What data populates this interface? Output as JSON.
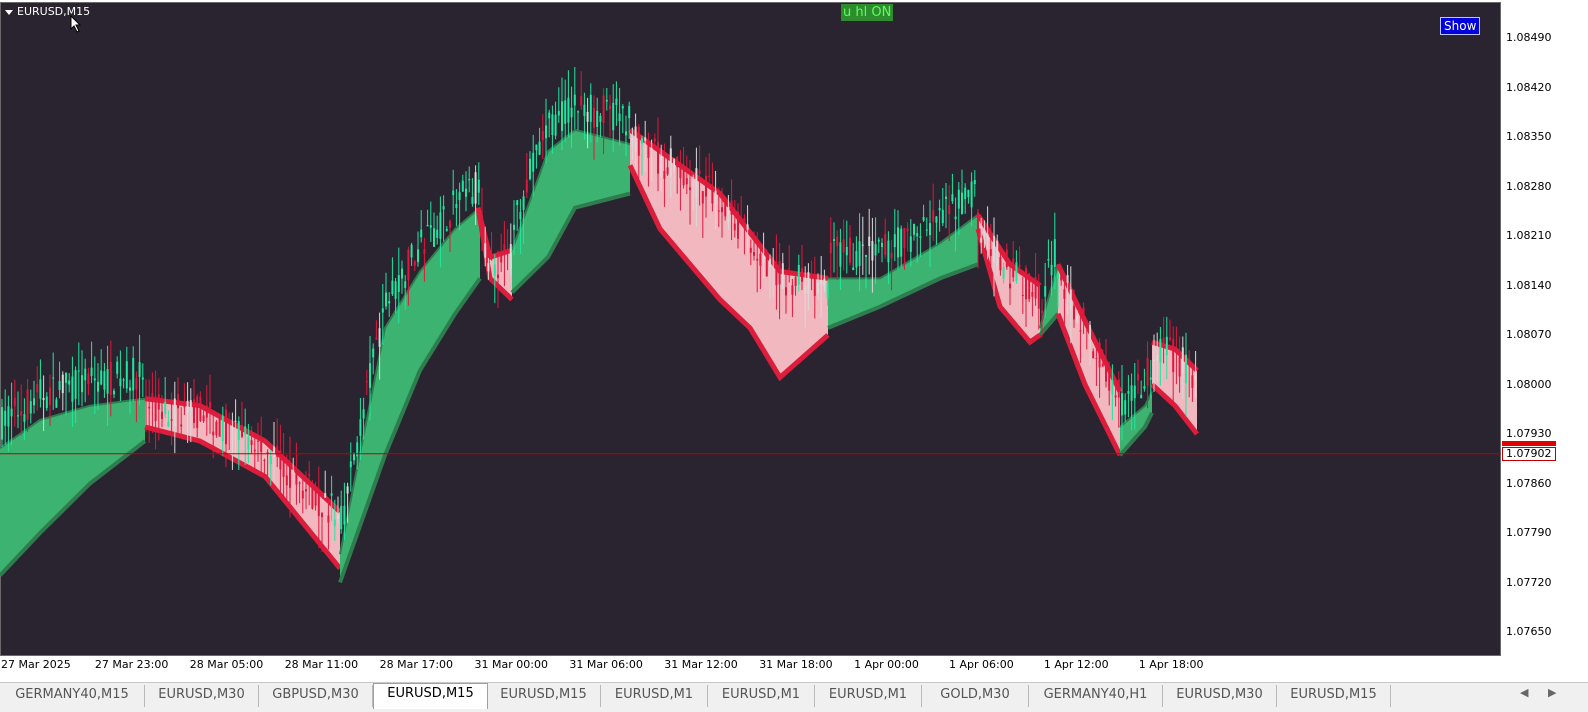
{
  "chart_data": {
    "type": "candlestick",
    "symbol_label": "EURUSD,M15",
    "indicator_label": "u hl ON",
    "show_button_label": "Show",
    "current_price": "1.07902",
    "current_price_value": 1.07902,
    "ylim": [
      1.0761,
      1.0854
    ],
    "y_ticks": [
      "1.08490",
      "1.08420",
      "1.08350",
      "1.08280",
      "1.08210",
      "1.08140",
      "1.08070",
      "1.08000",
      "1.07930",
      "1.07860",
      "1.07790",
      "1.07720",
      "1.07650"
    ],
    "x_ticks": [
      "27 Mar 2025",
      "27 Mar 23:00",
      "28 Mar 05:00",
      "28 Mar 11:00",
      "28 Mar 17:00",
      "31 Mar 00:00",
      "31 Mar 06:00",
      "31 Mar 12:00",
      "31 Mar 18:00",
      "1 Apr 00:00",
      "1 Apr 06:00",
      "1 Apr 12:00",
      "1 Apr 18:00"
    ],
    "colors": {
      "background": "#29242f",
      "bull_candle": "#1de9a0",
      "bear_candle": "#e0173c",
      "neutral_candle": "#d9d9d9",
      "band_up_fill": "#3cb371",
      "band_up_edge": "#2e7d4f",
      "band_down_fill": "#f2b8c0",
      "band_down_edge": "#dc1e3c",
      "price_line": "#c00000"
    }
  },
  "tabs": [
    {
      "label": "GERMANY40,M15",
      "active": false
    },
    {
      "label": "EURUSD,M30",
      "active": false
    },
    {
      "label": "GBPUSD,M30",
      "active": false
    },
    {
      "label": "EURUSD,M15",
      "active": true
    },
    {
      "label": "EURUSD,M15",
      "active": false
    },
    {
      "label": "EURUSD,M1",
      "active": false
    },
    {
      "label": "EURUSD,M1",
      "active": false
    },
    {
      "label": "EURUSD,M1",
      "active": false
    },
    {
      "label": "GOLD,M30",
      "active": false
    },
    {
      "label": "GERMANY40,H1",
      "active": false
    },
    {
      "label": "EURUSD,M30",
      "active": false
    },
    {
      "label": "EURUSD,M15",
      "active": false
    }
  ],
  "nav": {
    "left": "◀",
    "right": "▶"
  }
}
